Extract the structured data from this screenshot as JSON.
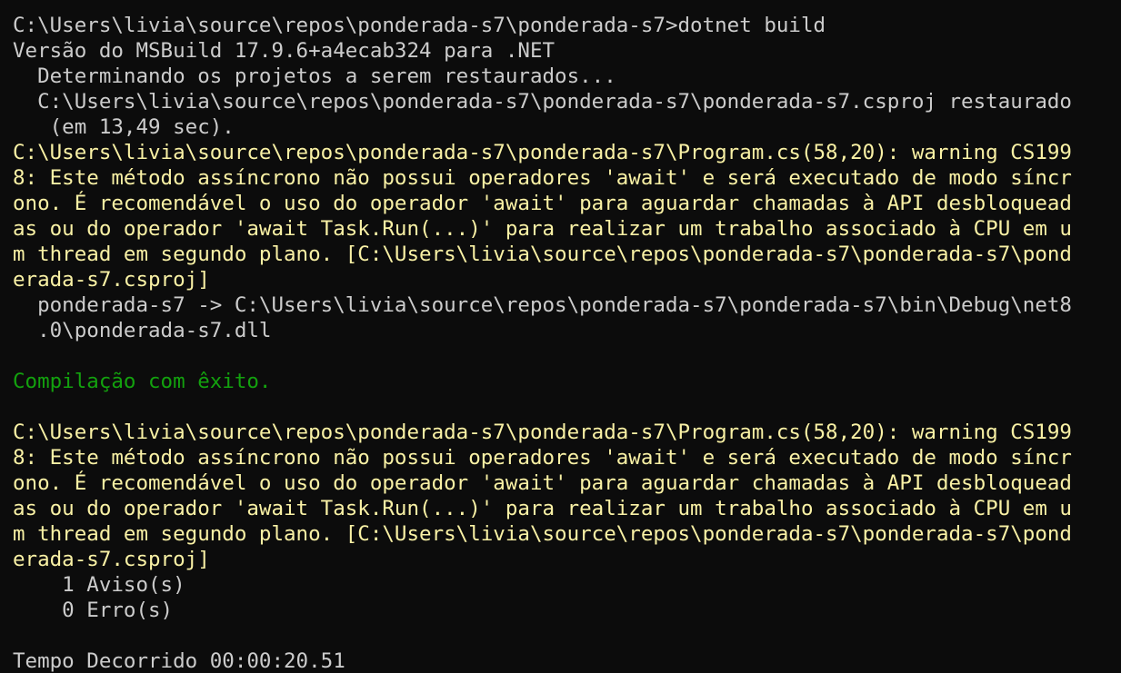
{
  "terminal": {
    "colors": {
      "background": "#0c0c0c",
      "foreground": "#cccccc",
      "warning": "#f9f1a5",
      "success": "#13a10e"
    },
    "lines": [
      {
        "text": "C:\\Users\\livia\\source\\repos\\ponderada-s7\\ponderada-s7>dotnet build",
        "kind": "normal"
      },
      {
        "text": "Versão do MSBuild 17.9.6+a4ecab324 para .NET",
        "kind": "normal"
      },
      {
        "text": "  Determinando os projetos a serem restaurados...",
        "kind": "normal"
      },
      {
        "text": "  C:\\Users\\livia\\source\\repos\\ponderada-s7\\ponderada-s7\\ponderada-s7.csproj restaurado",
        "kind": "normal"
      },
      {
        "text": "   (em 13,49 sec).",
        "kind": "normal"
      },
      {
        "text": "C:\\Users\\livia\\source\\repos\\ponderada-s7\\ponderada-s7\\Program.cs(58,20): warning CS199",
        "kind": "warn"
      },
      {
        "text": "8: Este método assíncrono não possui operadores 'await' e será executado de modo síncr",
        "kind": "warn"
      },
      {
        "text": "ono. É recomendável o uso do operador 'await' para aguardar chamadas à API desbloquead",
        "kind": "warn"
      },
      {
        "text": "as ou do operador 'await Task.Run(...)' para realizar um trabalho associado à CPU em u",
        "kind": "warn"
      },
      {
        "text": "m thread em segundo plano. [C:\\Users\\livia\\source\\repos\\ponderada-s7\\ponderada-s7\\pond",
        "kind": "warn"
      },
      {
        "text": "erada-s7.csproj]",
        "kind": "warn"
      },
      {
        "text": "  ponderada-s7 -> C:\\Users\\livia\\source\\repos\\ponderada-s7\\ponderada-s7\\bin\\Debug\\net8",
        "kind": "normal"
      },
      {
        "text": "  .0\\ponderada-s7.dll",
        "kind": "normal"
      },
      {
        "text": "",
        "kind": "normal"
      },
      {
        "text": "Compilação com êxito.",
        "kind": "ok"
      },
      {
        "text": "",
        "kind": "normal"
      },
      {
        "text": "C:\\Users\\livia\\source\\repos\\ponderada-s7\\ponderada-s7\\Program.cs(58,20): warning CS199",
        "kind": "warn"
      },
      {
        "text": "8: Este método assíncrono não possui operadores 'await' e será executado de modo síncr",
        "kind": "warn"
      },
      {
        "text": "ono. É recomendável o uso do operador 'await' para aguardar chamadas à API desbloquead",
        "kind": "warn"
      },
      {
        "text": "as ou do operador 'await Task.Run(...)' para realizar um trabalho associado à CPU em u",
        "kind": "warn"
      },
      {
        "text": "m thread em segundo plano. [C:\\Users\\livia\\source\\repos\\ponderada-s7\\ponderada-s7\\pond",
        "kind": "warn"
      },
      {
        "text": "erada-s7.csproj]",
        "kind": "warn"
      },
      {
        "text": "    1 Aviso(s)",
        "kind": "normal"
      },
      {
        "text": "    0 Erro(s)",
        "kind": "normal"
      },
      {
        "text": "",
        "kind": "normal"
      },
      {
        "text": "Tempo Decorrido 00:00:20.51",
        "kind": "normal"
      }
    ]
  }
}
